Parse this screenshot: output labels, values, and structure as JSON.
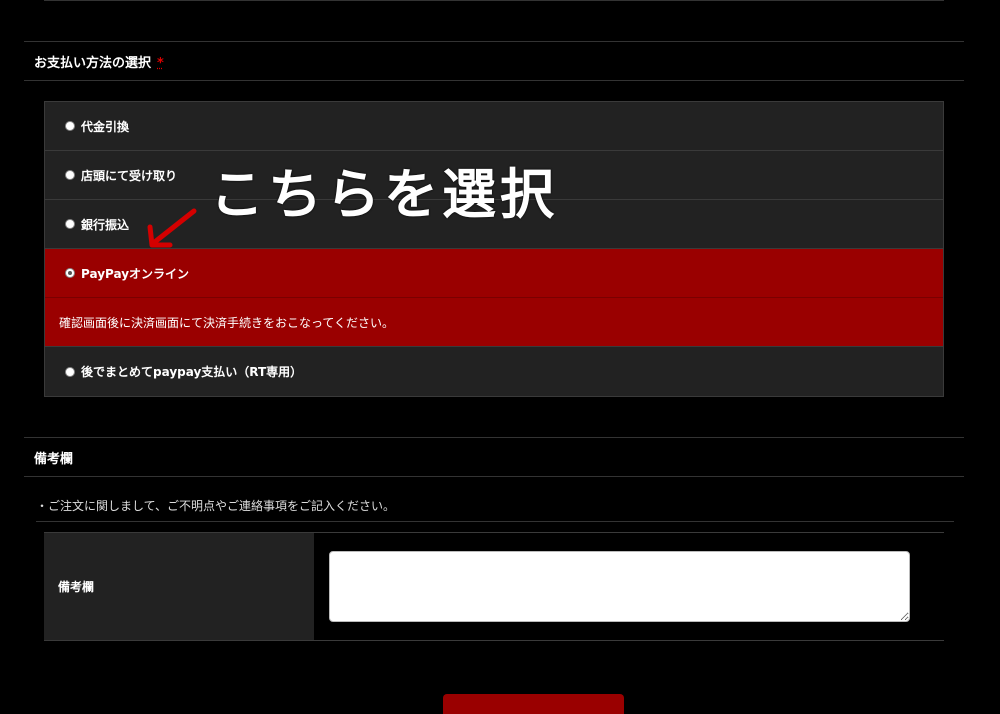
{
  "payment": {
    "section_title": "お支払い方法の選択",
    "required_mark": "*",
    "options": [
      {
        "label": "代金引換",
        "selected": false
      },
      {
        "label": "店頭にて受け取り",
        "selected": false
      },
      {
        "label": "銀行振込",
        "selected": false
      },
      {
        "label": "PayPayオンライン",
        "selected": true,
        "description": "確認画面後に決済画面にて決済手続きをおこなってください。"
      },
      {
        "label": "後でまとめてpaypay支払い（RT専用）",
        "selected": false
      }
    ]
  },
  "annotation": {
    "callout_text": "こちらを選択",
    "arrow_icon": "arrow-pointer-icon",
    "arrow_color": "#d40000"
  },
  "remarks": {
    "section_title": "備考欄",
    "note": "・ご注文に関しまして、ご不明点やご連絡事項をご記入ください。",
    "field_label": "備考欄",
    "field_value": ""
  },
  "colors": {
    "background": "#000000",
    "row_background": "#222222",
    "selected_background": "#9a0000",
    "required": "#e00000"
  }
}
